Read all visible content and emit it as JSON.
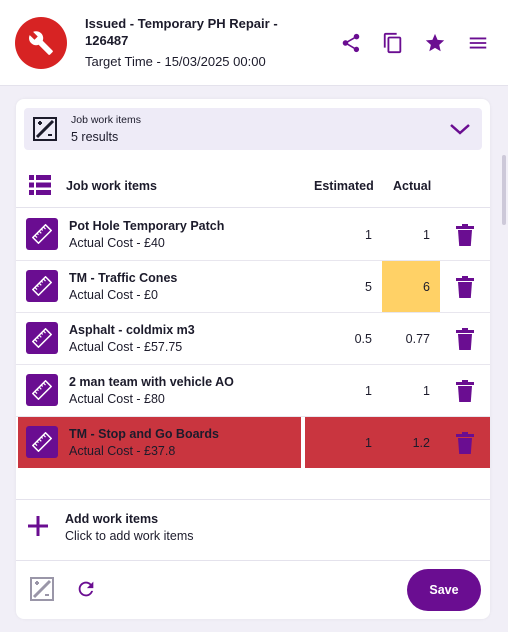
{
  "header": {
    "title": "Issued - Temporary PH Repair - 126487",
    "target_time": "Target Time - 15/03/2025 00:00",
    "icons": [
      "wrench-icon",
      "share-icon",
      "copy-icon",
      "star-icon",
      "menu-icon"
    ]
  },
  "selector": {
    "label": "Job work items",
    "count": "5 results"
  },
  "table": {
    "headers": {
      "name": "Job work items",
      "estimated": "Estimated",
      "actual": "Actual"
    },
    "rows": [
      {
        "name": "Pot Hole Temporary Patch",
        "cost": "Actual Cost - £40",
        "estimated": "1",
        "actual": "1",
        "state": "normal"
      },
      {
        "name": "TM - Traffic Cones",
        "cost": "Actual Cost - £0",
        "estimated": "5",
        "actual": "6",
        "state": "actual-highlight"
      },
      {
        "name": "Asphalt - coldmix m3",
        "cost": "Actual Cost - £57.75",
        "estimated": "0.5",
        "actual": "0.77",
        "state": "normal"
      },
      {
        "name": "2 man team with vehicle AO",
        "cost": "Actual Cost - £80",
        "estimated": "1",
        "actual": "1",
        "state": "normal"
      },
      {
        "name": "TM - Stop and Go Boards",
        "cost": "Actual Cost - £37.8",
        "estimated": "1",
        "actual": "1.2",
        "state": "selected"
      }
    ]
  },
  "add": {
    "label": "Add work items",
    "hint": "Click to add work items"
  },
  "footer": {
    "save_label": "Save"
  },
  "colors": {
    "brand": "#6a0d91",
    "logo": "#d72323",
    "highlight": "#ffd166",
    "selected_row": "#c9353f"
  }
}
